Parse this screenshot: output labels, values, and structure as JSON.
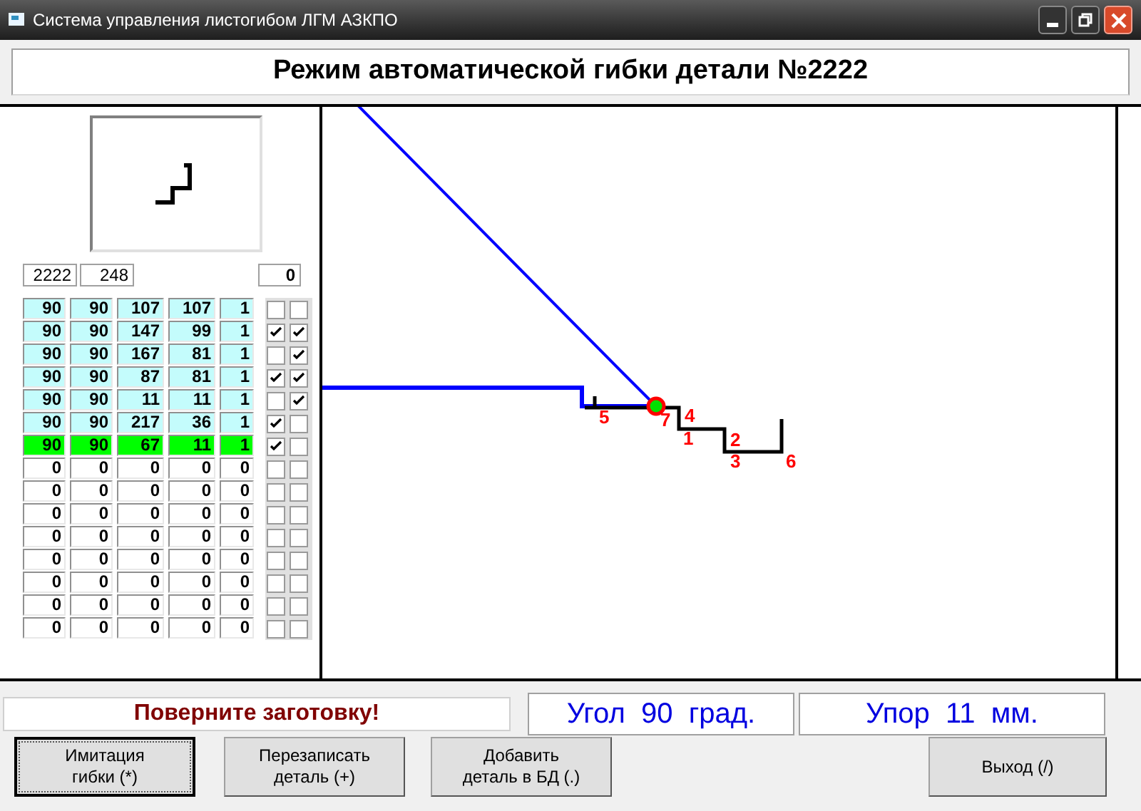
{
  "window": {
    "title": "Система управления листогибом ЛГМ  АЗКПО"
  },
  "header": "Режим автоматической гибки детали №2222",
  "part_fields": [
    "2222",
    "248"
  ],
  "counter": "0",
  "rows": [
    {
      "kind": "programmed",
      "selected": false,
      "values": [
        "90",
        "90",
        "107",
        "107",
        "1"
      ],
      "check_a": false,
      "check_b": false
    },
    {
      "kind": "programmed",
      "selected": false,
      "values": [
        "90",
        "90",
        "147",
        "99",
        "1"
      ],
      "check_a": true,
      "check_b": true
    },
    {
      "kind": "programmed",
      "selected": false,
      "values": [
        "90",
        "90",
        "167",
        "81",
        "1"
      ],
      "check_a": false,
      "check_b": true
    },
    {
      "kind": "programmed",
      "selected": false,
      "values": [
        "90",
        "90",
        "87",
        "81",
        "1"
      ],
      "check_a": true,
      "check_b": true
    },
    {
      "kind": "programmed",
      "selected": false,
      "values": [
        "90",
        "90",
        "11",
        "11",
        "1"
      ],
      "check_a": false,
      "check_b": true
    },
    {
      "kind": "programmed",
      "selected": false,
      "values": [
        "90",
        "90",
        "217",
        "36",
        "1"
      ],
      "check_a": true,
      "check_b": false
    },
    {
      "kind": "programmed",
      "selected": true,
      "values": [
        "90",
        "90",
        "67",
        "11",
        "1"
      ],
      "check_a": true,
      "check_b": false
    },
    {
      "kind": "empty",
      "selected": false,
      "values": [
        "0",
        "0",
        "0",
        "0",
        "0"
      ],
      "check_a": false,
      "check_b": false
    },
    {
      "kind": "empty",
      "selected": false,
      "values": [
        "0",
        "0",
        "0",
        "0",
        "0"
      ],
      "check_a": false,
      "check_b": false
    },
    {
      "kind": "empty",
      "selected": false,
      "values": [
        "0",
        "0",
        "0",
        "0",
        "0"
      ],
      "check_a": false,
      "check_b": false
    },
    {
      "kind": "empty",
      "selected": false,
      "values": [
        "0",
        "0",
        "0",
        "0",
        "0"
      ],
      "check_a": false,
      "check_b": false
    },
    {
      "kind": "empty",
      "selected": false,
      "values": [
        "0",
        "0",
        "0",
        "0",
        "0"
      ],
      "check_a": false,
      "check_b": false
    },
    {
      "kind": "empty",
      "selected": false,
      "values": [
        "0",
        "0",
        "0",
        "0",
        "0"
      ],
      "check_a": false,
      "check_b": false
    },
    {
      "kind": "empty",
      "selected": false,
      "values": [
        "0",
        "0",
        "0",
        "0",
        "0"
      ],
      "check_a": false,
      "check_b": false
    },
    {
      "kind": "empty",
      "selected": false,
      "values": [
        "0",
        "0",
        "0",
        "0",
        "0"
      ],
      "check_a": false,
      "check_b": false
    }
  ],
  "bend_labels": [
    "5",
    "7",
    "4",
    "1",
    "2",
    "3",
    "6"
  ],
  "status": {
    "message": "Поверните заготовку!",
    "angle": "Угол  90  град.",
    "stop": "Упор  11  мм."
  },
  "buttons": [
    {
      "label": "Имитация\nгибки (*)",
      "focused": true
    },
    {
      "label": "Перезаписать\nдеталь (+)",
      "focused": false
    },
    {
      "label": "Добавить\nдеталь в БД (.)",
      "focused": false
    },
    {
      "label": "Выход (/)",
      "focused": false
    }
  ]
}
